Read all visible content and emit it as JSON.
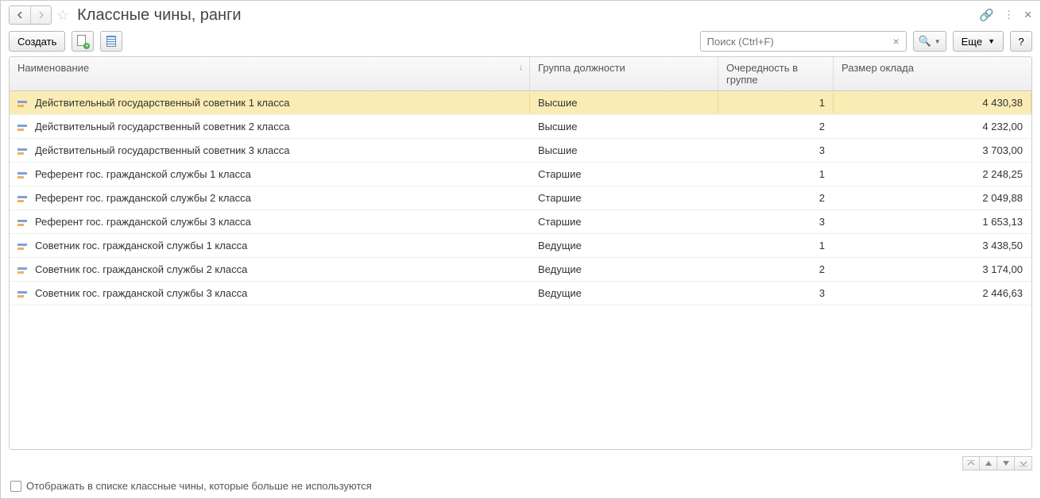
{
  "header": {
    "title": "Классные чины, ранги"
  },
  "toolbar": {
    "create_label": "Создать",
    "more_label": "Еще",
    "help_label": "?",
    "search_placeholder": "Поиск (Ctrl+F)"
  },
  "columns": {
    "name": "Наименование",
    "group": "Группа должности",
    "order": "Очередность в группе",
    "salary": "Размер оклада"
  },
  "rows": [
    {
      "name": "Действительный государственный советник 1 класса",
      "group": "Высшие",
      "order": "1",
      "salary": "4 430,38",
      "selected": true
    },
    {
      "name": "Действительный государственный советник 2 класса",
      "group": "Высшие",
      "order": "2",
      "salary": "4 232,00"
    },
    {
      "name": "Действительный государственный советник 3 класса",
      "group": "Высшие",
      "order": "3",
      "salary": "3 703,00"
    },
    {
      "name": "Референт гос. гражданской службы 1 класса",
      "group": "Старшие",
      "order": "1",
      "salary": "2 248,25"
    },
    {
      "name": "Референт гос. гражданской службы 2 класса",
      "group": "Старшие",
      "order": "2",
      "salary": "2 049,88"
    },
    {
      "name": "Референт гос. гражданской службы 3 класса",
      "group": "Старшие",
      "order": "3",
      "salary": "1 653,13"
    },
    {
      "name": "Советник гос. гражданской службы 1 класса",
      "group": "Ведущие",
      "order": "1",
      "salary": "3 438,50"
    },
    {
      "name": "Советник гос. гражданской службы 2 класса",
      "group": "Ведущие",
      "order": "2",
      "salary": "3 174,00"
    },
    {
      "name": "Советник гос. гражданской службы 3 класса",
      "group": "Ведущие",
      "order": "3",
      "salary": "2 446,63"
    }
  ],
  "footer": {
    "show_obsolete_label": "Отображать в списке классные чины, которые больше не используются"
  }
}
